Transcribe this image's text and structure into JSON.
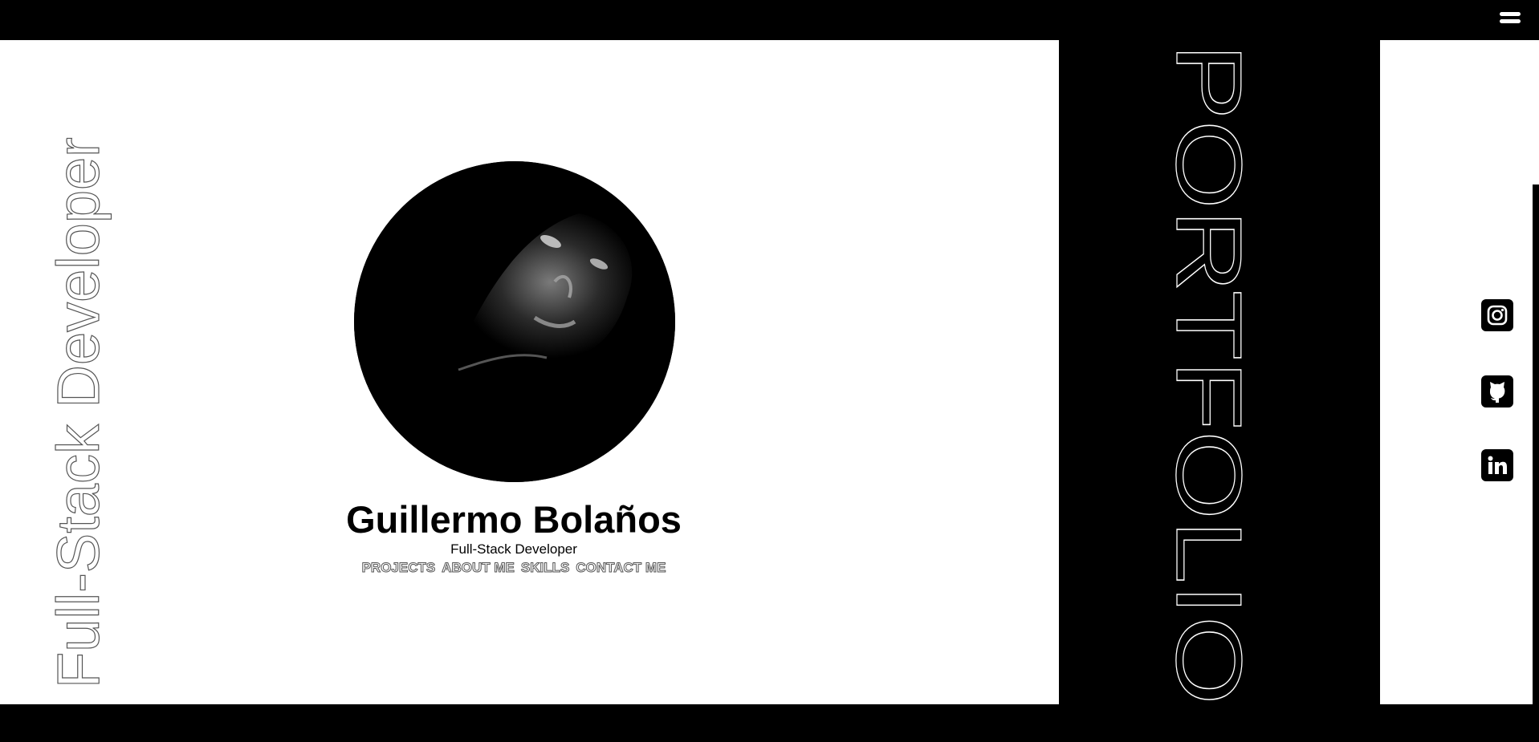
{
  "menu": {
    "icon": "hamburger-menu-icon"
  },
  "side_text": {
    "role": "Full-Stack Developer",
    "portfolio": "PORTFOLIO"
  },
  "profile": {
    "name": "Guillermo Bolaños",
    "role": "Full-Stack Developer",
    "nav": [
      "PROJECTS",
      "ABOUT ME",
      "SKILLS",
      "CONTACT ME"
    ]
  },
  "social": [
    {
      "name": "instagram",
      "icon": "instagram-icon"
    },
    {
      "name": "github",
      "icon": "github-icon"
    },
    {
      "name": "linkedin",
      "icon": "linkedin-icon"
    }
  ],
  "colors": {
    "background": "#000000",
    "panel": "#ffffff",
    "text": "#000000",
    "outline": "#555555"
  }
}
